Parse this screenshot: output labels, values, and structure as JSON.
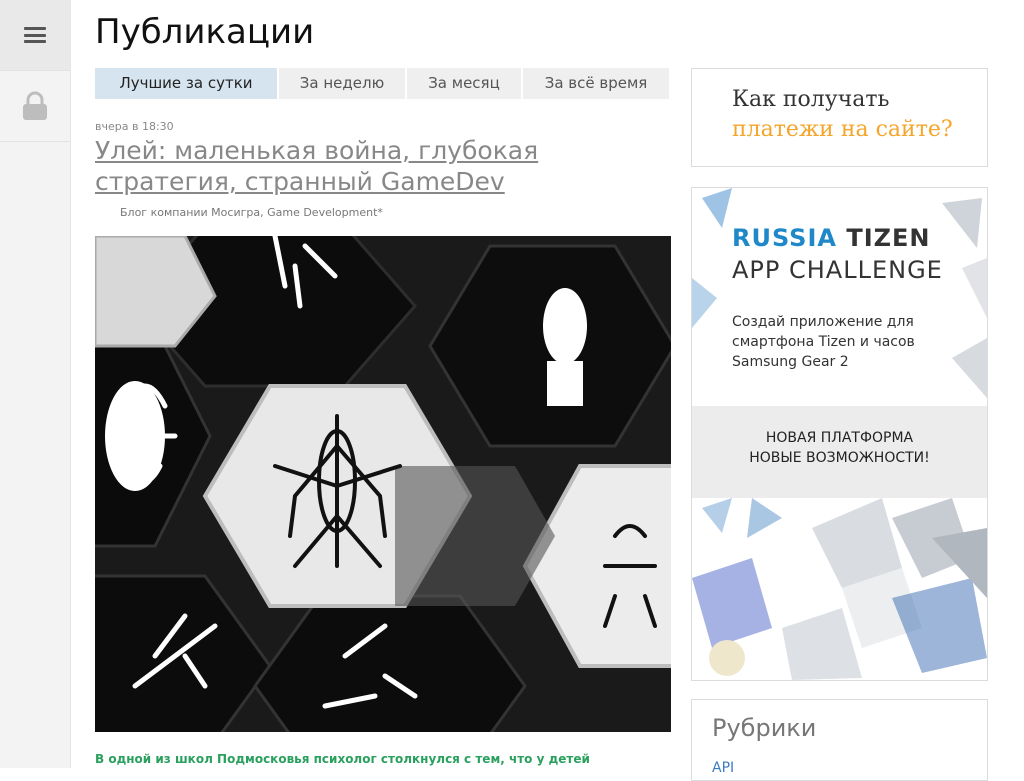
{
  "page_title": "Публикации",
  "tabs": [
    {
      "label": "Лучшие за сутки",
      "active": true
    },
    {
      "label": "За неделю",
      "active": false
    },
    {
      "label": "За месяц",
      "active": false
    },
    {
      "label": "За всё время",
      "active": false
    }
  ],
  "post": {
    "date": "вчера в 18:30",
    "title": "Улей: маленькая война, глубокая стратегия, странный GameDev",
    "hubs": "Блог компании Мосигра, Game Development*",
    "lead": "В одной из школ Подмосковья психолог столкнулся с тем, что у детей"
  },
  "sidebar_icons": [
    "menu-icon",
    "lock-icon"
  ],
  "ad_payments": {
    "line1": "Как получать",
    "line2": "платежи на сайте?",
    "accent": "#f4a52a"
  },
  "ad_tizen": {
    "brand_part1": "RUSSIA",
    "brand_part2": "TIZEN",
    "challenge": "APP CHALLENGE",
    "description": "Создай приложение для смартфона Tizen и часов Samsung Gear 2",
    "slogan1": "НОВАЯ ПЛАТФОРМА",
    "slogan2": "НОВЫЕ ВОЗМОЖНОСТИ!",
    "accent": "#1e88c8"
  },
  "rubrics": {
    "heading": "Рубрики",
    "first_item": "API"
  }
}
